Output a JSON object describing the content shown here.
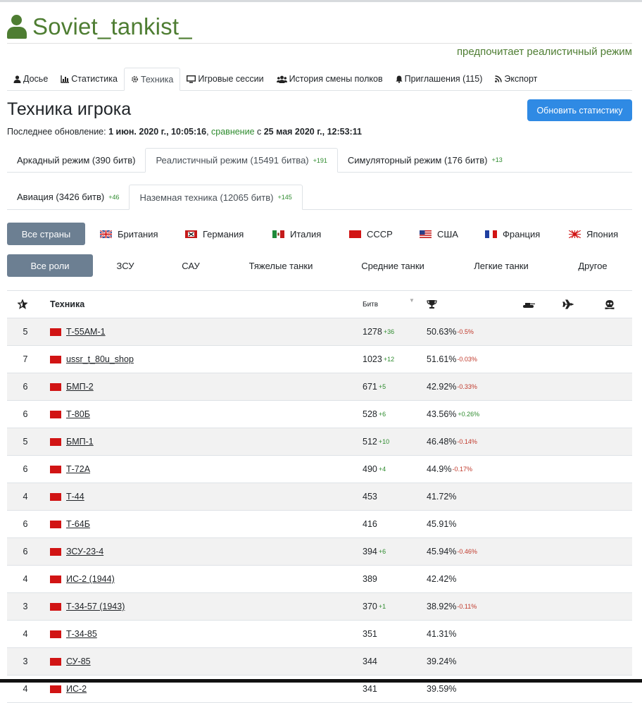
{
  "profile": {
    "username": "Soviet_tankist_",
    "preference": "предпочитает реалистичный режим"
  },
  "nav_tabs": [
    {
      "label": "Досье",
      "icon": "user-icon"
    },
    {
      "label": "Статистика",
      "icon": "chart-icon"
    },
    {
      "label": "Техника",
      "icon": "gear-icon"
    },
    {
      "label": "Игровые сессии",
      "icon": "monitor-icon"
    },
    {
      "label": "История смены полков",
      "icon": "users-icon"
    },
    {
      "label": "Приглашения (115)",
      "icon": "bell-icon"
    },
    {
      "label": "Экспорт",
      "icon": "rss-icon"
    }
  ],
  "page": {
    "title": "Техника игрока",
    "refresh_label": "Обновить статистику",
    "last_update_prefix": "Последнее обновление: ",
    "last_update_date": "1 июн. 2020 г., 10:05:16",
    "comma": ", ",
    "compare_label": "сравнение",
    "compare_with": " с ",
    "compare_date": "25 мая 2020 г., 12:53:11"
  },
  "mode_tabs": [
    {
      "label": "Аркадный режим (390 битв)",
      "delta": ""
    },
    {
      "label": "Реалистичный режим (15491 битва)",
      "delta": "+191"
    },
    {
      "label": "Симуляторный режим (176 битв)",
      "delta": "+13"
    }
  ],
  "vehicle_tabs": [
    {
      "label": "Авиация (3426 битв)",
      "delta": "+46"
    },
    {
      "label": "Наземная техника (12065 битв)",
      "delta": "+145"
    }
  ],
  "countries": {
    "all_label": "Все страны",
    "items": [
      "Британия",
      "Германия",
      "Италия",
      "СССР",
      "США",
      "Франция",
      "Япония"
    ]
  },
  "roles": {
    "all_label": "Все роли",
    "items": [
      "ЗСУ",
      "САУ",
      "Тяжелые танки",
      "Средние танки",
      "Легкие танки",
      "Другое"
    ]
  },
  "table": {
    "col_name": "Техника",
    "col_battles": "Битв",
    "rows": [
      {
        "rank": "5",
        "name": "Т-55АМ-1",
        "battles": "1278",
        "battles_delta": "+36",
        "win": "50.63%",
        "win_delta": "-0.5%",
        "win_delta_positive": false
      },
      {
        "rank": "7",
        "name": "ussr_t_80u_shop",
        "battles": "1023",
        "battles_delta": "+12",
        "win": "51.61%",
        "win_delta": "-0.03%",
        "win_delta_positive": false
      },
      {
        "rank": "6",
        "name": "БМП-2",
        "battles": "671",
        "battles_delta": "+5",
        "win": "42.92%",
        "win_delta": "-0.33%",
        "win_delta_positive": false
      },
      {
        "rank": "6",
        "name": "Т-80Б",
        "battles": "528",
        "battles_delta": "+6",
        "win": "43.56%",
        "win_delta": "+0.26%",
        "win_delta_positive": true
      },
      {
        "rank": "5",
        "name": "БМП-1",
        "battles": "512",
        "battles_delta": "+10",
        "win": "46.48%",
        "win_delta": "-0.14%",
        "win_delta_positive": false
      },
      {
        "rank": "6",
        "name": "Т-72А",
        "battles": "490",
        "battles_delta": "+4",
        "win": "44.9%",
        "win_delta": "-0.17%",
        "win_delta_positive": false
      },
      {
        "rank": "4",
        "name": "Т-44",
        "battles": "453",
        "battles_delta": "",
        "win": "41.72%",
        "win_delta": "",
        "win_delta_positive": false
      },
      {
        "rank": "6",
        "name": "Т-64Б",
        "battles": "416",
        "battles_delta": "",
        "win": "45.91%",
        "win_delta": "",
        "win_delta_positive": false
      },
      {
        "rank": "6",
        "name": "ЗСУ-23-4",
        "battles": "394",
        "battles_delta": "+6",
        "win": "45.94%",
        "win_delta": "-0.46%",
        "win_delta_positive": false
      },
      {
        "rank": "4",
        "name": "ИС-2 (1944)",
        "battles": "389",
        "battles_delta": "",
        "win": "42.42%",
        "win_delta": "",
        "win_delta_positive": false
      },
      {
        "rank": "3",
        "name": "Т-34-57 (1943)",
        "battles": "370",
        "battles_delta": "+1",
        "win": "38.92%",
        "win_delta": "-0.11%",
        "win_delta_positive": false
      },
      {
        "rank": "4",
        "name": "Т-34-85",
        "battles": "351",
        "battles_delta": "",
        "win": "41.31%",
        "win_delta": "",
        "win_delta_positive": false
      },
      {
        "rank": "3",
        "name": "СУ-85",
        "battles": "344",
        "battles_delta": "",
        "win": "39.24%",
        "win_delta": "",
        "win_delta_positive": false
      },
      {
        "rank": "4",
        "name": "ИС-2",
        "battles": "341",
        "battles_delta": "",
        "win": "39.59%",
        "win_delta": "",
        "win_delta_positive": false
      }
    ]
  }
}
